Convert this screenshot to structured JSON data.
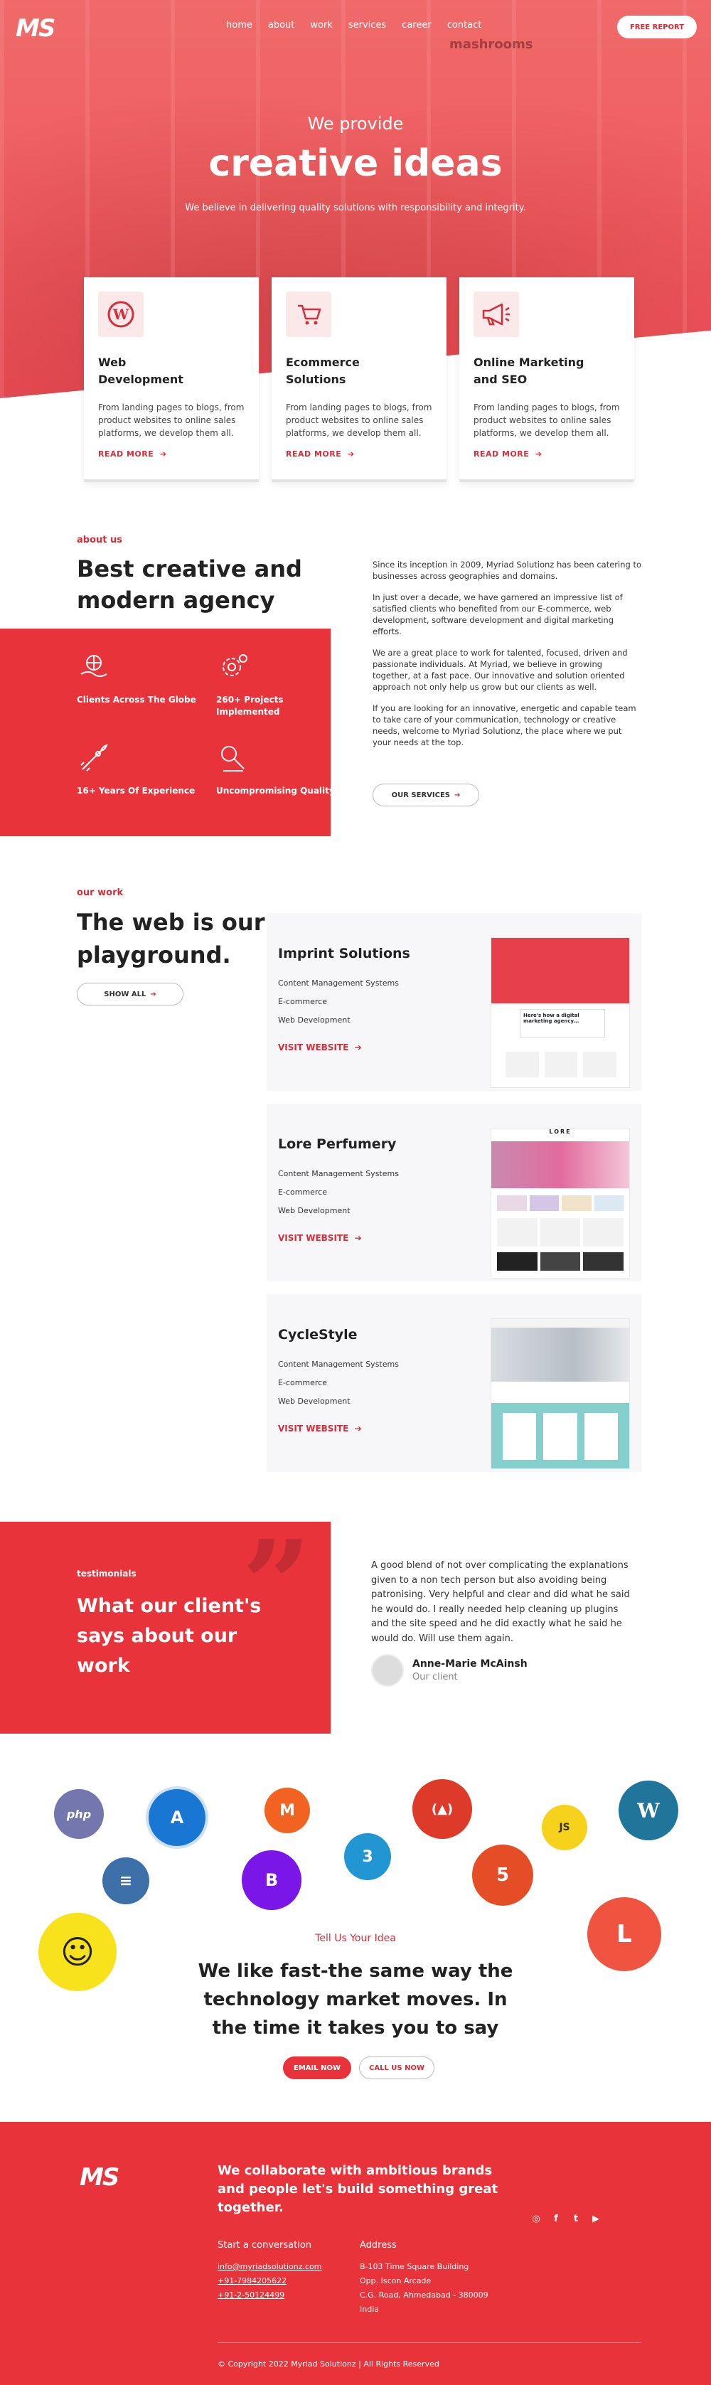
{
  "brand": {
    "logo_text": "MS",
    "accent": "#e8333b"
  },
  "nav": {
    "items": [
      "home",
      "about",
      "work",
      "services",
      "career",
      "contact"
    ],
    "cta": "FREE REPORT"
  },
  "hero": {
    "subtitle": "We provide",
    "title": "creative ideas",
    "tagline": "We believe in delivering quality solutions with responsibility and integrity.",
    "sign_text": "mashrooms"
  },
  "services": [
    {
      "icon": "wordpress-icon",
      "title": "Web Development",
      "text": "From landing pages to blogs, from product websites to online sales platforms, we develop them all.",
      "link": "READ MORE"
    },
    {
      "icon": "cart-icon",
      "title": "Ecommerce Solutions",
      "text": "From landing pages to blogs, from product websites to online sales platforms, we develop them all.",
      "link": "READ MORE"
    },
    {
      "icon": "megaphone-icon",
      "title": "Online Marketing and SEO",
      "text": "From landing pages to blogs, from product websites to online sales platforms, we develop them all.",
      "link": "READ MORE"
    }
  ],
  "about": {
    "label": "about us",
    "title": "Best creative and modern agency",
    "features": [
      {
        "icon": "globe-hand-icon",
        "text": "Clients Across The Globe"
      },
      {
        "icon": "gear-brain-icon",
        "text": "260+ Projects Implemented"
      },
      {
        "icon": "rocket-icon",
        "text": "16+ Years Of Experience"
      },
      {
        "icon": "quality-icon",
        "text": "Uncompromising Quality"
      }
    ],
    "paragraphs": [
      "Since its inception in 2009, Myriad Solutionz has been catering to businesses across geographies and domains.",
      "In just over a decade, we have garnered an impressive list of satisfied clients who benefited from our E-commerce, web development, software development and digital marketing efforts.",
      "We are a great place to work for talented, focused, driven and passionate individuals. At Myriad, we believe in growing together, at a fast pace. Our innovative and solution oriented approach not only help us grow but our clients as well.",
      "If you are looking for an innovative, energetic and capable team to take care of your communication, technology or creative needs, welcome to Myriad Solutionz, the place where we put your needs at the top."
    ],
    "button": "OUR SERVICES"
  },
  "work": {
    "label": "our work",
    "title": "The web is our playground.",
    "button": "SHOW ALL",
    "projects": [
      {
        "name": "Imprint Solutions",
        "tags": [
          "Content Management Systems",
          "E-commerce",
          "Web Development"
        ],
        "link": "VISIT WEBSITE",
        "shot_headline": "Here's how a digital marketing agency..."
      },
      {
        "name": "Lore Perfumery",
        "tags": [
          "Content Management Systems",
          "E-commerce",
          "Web Development"
        ],
        "link": "VISIT WEBSITE",
        "shot_headline": "LORE"
      },
      {
        "name": "CycleStyle",
        "tags": [
          "Content Management Systems",
          "E-commerce",
          "Web Development"
        ],
        "link": "VISIT WEBSITE",
        "shot_headline": ""
      }
    ]
  },
  "testimonial": {
    "label": "testimonials",
    "title": "What our client's says about our work",
    "quote": "A good blend of not over complicating the explanations given to a non tech person but also avoiding being patronising. Very helpful and clear and did what he said he would do. I really needed help cleaning up plugins and the site speed and he did exactly what he said he would do. Will use them again.",
    "author": "Anne-Marie McAinsh",
    "role": "Our client"
  },
  "tech": {
    "bubbles": [
      {
        "name": "php-icon",
        "label": "php",
        "color": "#7377ad"
      },
      {
        "name": "angular-icon",
        "label": "A",
        "color": "#1976d2"
      },
      {
        "name": "magento-icon",
        "label": "M",
        "color": "#f26322"
      },
      {
        "name": "codeigniter-icon",
        "label": "(▲)",
        "color": "#dd3a2a"
      },
      {
        "name": "nodejs-icon",
        "label": "JS",
        "color": "#f7d21c"
      },
      {
        "name": "wordpress-icon",
        "label": "W",
        "color": "#21759b"
      },
      {
        "name": "database-icon",
        "label": "≡",
        "color": "#3d6fa8"
      },
      {
        "name": "bootstrap-icon",
        "label": "B",
        "color": "#7b16e8"
      },
      {
        "name": "css3-icon",
        "label": "3",
        "color": "#2196d3"
      },
      {
        "name": "html5-icon",
        "label": "5",
        "color": "#e44d26"
      },
      {
        "name": "mailchimp-icon",
        "label": "☺",
        "color": "#f8e21b"
      },
      {
        "name": "laravel-icon",
        "label": "L",
        "color": "#f05340"
      }
    ]
  },
  "cta": {
    "label": "Tell Us Your Idea",
    "title": "We like fast-the same way the technology market moves. In the time it takes you to say",
    "email_btn": "EMAIL NOW",
    "call_btn": "CALL US NOW"
  },
  "footer": {
    "logo_text": "MS",
    "headline": "We collaborate with ambitious brands and people let's build something great together.",
    "conversation_title": "Start a conversation",
    "conversation_items": [
      "info@myriadsolutionz.com",
      "+91-7984205622",
      "+91-2-50124499"
    ],
    "address_title": "Address",
    "address_lines": [
      "B-103 Time Square Building",
      "Opp. Iscon Arcade",
      "C.G. Road, Ahmedabad - 380009",
      "India"
    ],
    "social": [
      "instagram-icon",
      "facebook-icon",
      "twitter-icon",
      "youtube-icon"
    ],
    "copyright": "© Copyright 2022 Myriad Solutionz | All Rights Reserved"
  }
}
